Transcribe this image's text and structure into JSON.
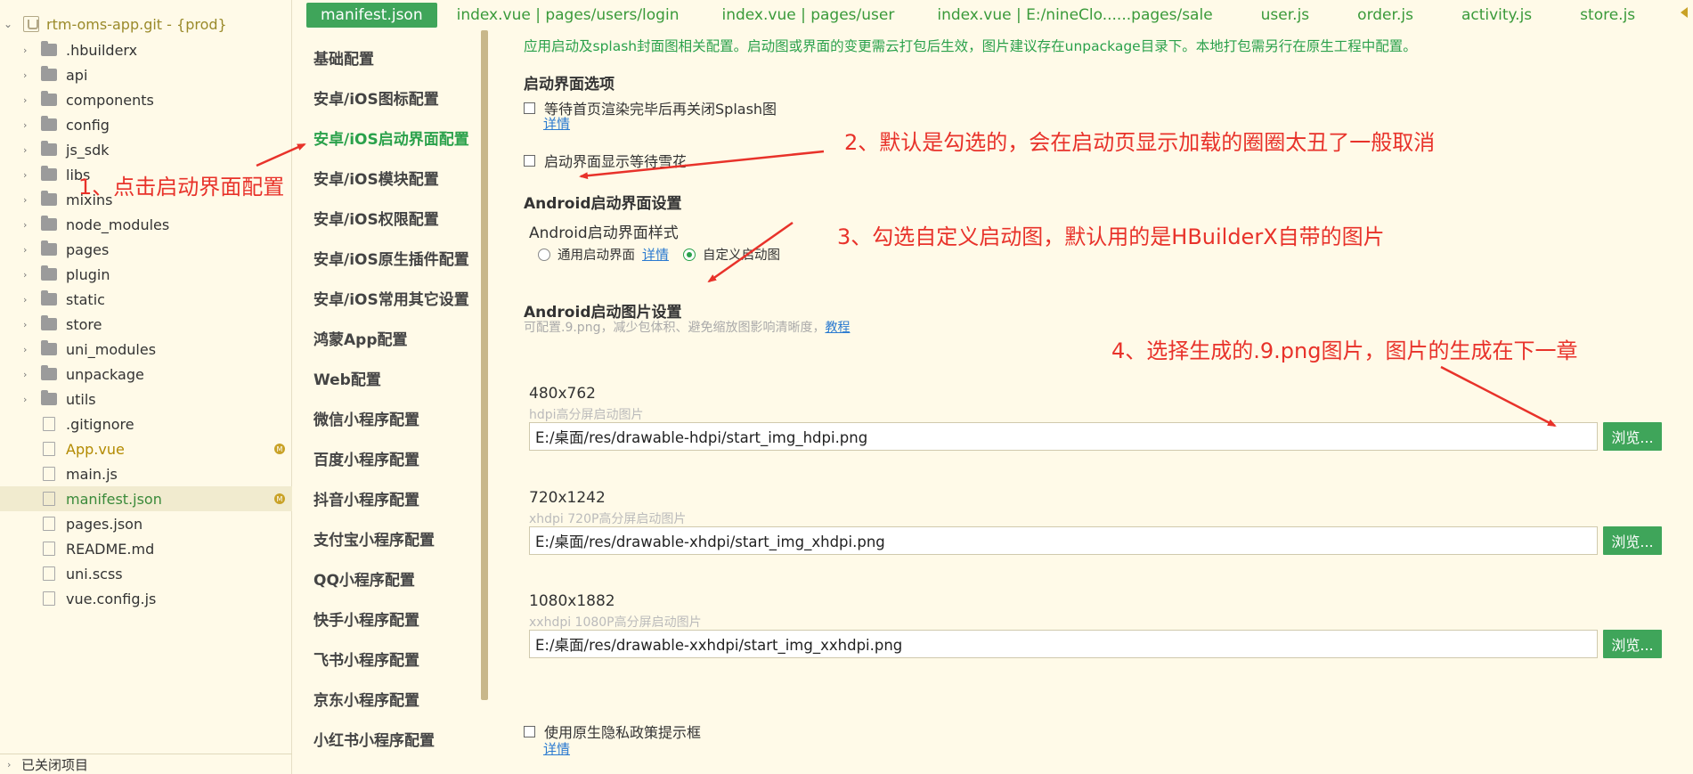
{
  "tree": {
    "root_label": "rtm-oms-app.git - {prod}",
    "items": [
      {
        "label": ".hbuilderx",
        "kind": "folder"
      },
      {
        "label": "api",
        "kind": "folder"
      },
      {
        "label": "components",
        "kind": "folder"
      },
      {
        "label": "config",
        "kind": "folder"
      },
      {
        "label": "js_sdk",
        "kind": "folder"
      },
      {
        "label": "libs",
        "kind": "folder"
      },
      {
        "label": "mixins",
        "kind": "folder"
      },
      {
        "label": "node_modules",
        "kind": "folder"
      },
      {
        "label": "pages",
        "kind": "folder"
      },
      {
        "label": "plugin",
        "kind": "folder"
      },
      {
        "label": "static",
        "kind": "folder"
      },
      {
        "label": "store",
        "kind": "folder"
      },
      {
        "label": "uni_modules",
        "kind": "folder"
      },
      {
        "label": "unpackage",
        "kind": "folder"
      },
      {
        "label": "utils",
        "kind": "folder"
      },
      {
        "label": ".gitignore",
        "kind": "file"
      },
      {
        "label": "App.vue",
        "kind": "file",
        "badge": "M"
      },
      {
        "label": "main.js",
        "kind": "file"
      },
      {
        "label": "manifest.json",
        "kind": "file",
        "badge": "M",
        "active": true
      },
      {
        "label": "pages.json",
        "kind": "file"
      },
      {
        "label": "README.md",
        "kind": "file"
      },
      {
        "label": "uni.scss",
        "kind": "file"
      },
      {
        "label": "vue.config.js",
        "kind": "file"
      }
    ],
    "footer_label": "已关闭项目"
  },
  "tabs": [
    {
      "label": "manifest.json",
      "active": true
    },
    {
      "label": "index.vue | pages/users/login"
    },
    {
      "label": "index.vue | pages/user"
    },
    {
      "label": "index.vue | E:/nineClo......pages/sale"
    },
    {
      "label": "user.js"
    },
    {
      "label": "order.js"
    },
    {
      "label": "activity.js"
    },
    {
      "label": "store.js"
    }
  ],
  "settings_nav": [
    {
      "label": "基础配置"
    },
    {
      "label": "安卓/iOS图标配置"
    },
    {
      "label": "安卓/iOS启动界面配置",
      "active": true
    },
    {
      "label": "安卓/iOS模块配置"
    },
    {
      "label": "安卓/iOS权限配置"
    },
    {
      "label": "安卓/iOS原生插件配置"
    },
    {
      "label": "安卓/iOS常用其它设置"
    },
    {
      "label": "鸿蒙App配置"
    },
    {
      "label": "Web配置"
    },
    {
      "label": "微信小程序配置"
    },
    {
      "label": "百度小程序配置"
    },
    {
      "label": "抖音小程序配置"
    },
    {
      "label": "支付宝小程序配置"
    },
    {
      "label": "QQ小程序配置"
    },
    {
      "label": "快手小程序配置"
    },
    {
      "label": "飞书小程序配置"
    },
    {
      "label": "京东小程序配置"
    },
    {
      "label": "小红书小程序配置"
    }
  ],
  "main": {
    "description": "应用启动及splash封面图相关配置。启动图或界面的变更需云打包后生效，图片建议存在unpackage目录下。本地打包需另行在原生工程中配置。",
    "splash_options_title": "启动界面选项",
    "option_wait_render": "等待首页渲染完毕后再关闭Splash图",
    "detail_link": "详情",
    "option_show_snow": "启动界面显示等待雪花",
    "android_section_title": "Android启动界面设置",
    "android_style_label": "Android启动界面样式",
    "radio_default": "通用启动界面",
    "radio_default_detail": "详情",
    "radio_custom": "自定义启动图",
    "android_images_title": "Android启动图片设置",
    "android_images_hint": "可配置.9.png，减少包体积、避免缩放图影响清晰度，",
    "android_images_hint_link": "教程",
    "images": [
      {
        "size": "480x762",
        "hint": "hdpi高分屏启动图片",
        "path": "E:/桌面/res/drawable-hdpi/start_img_hdpi.png",
        "button": "浏览..."
      },
      {
        "size": "720x1242",
        "hint": "xhdpi 720P高分屏启动图片",
        "path": "E:/桌面/res/drawable-xhdpi/start_img_xhdpi.png",
        "button": "浏览..."
      },
      {
        "size": "1080x1882",
        "hint": "xxhdpi 1080P高分屏启动图片",
        "path": "E:/桌面/res/drawable-xxhdpi/start_img_xxhdpi.png",
        "button": "浏览..."
      }
    ],
    "privacy_option": "使用原生隐私政策提示框",
    "privacy_detail": "详情"
  },
  "annotations": {
    "step1": "1、点击启动界面配置",
    "step2": "2、默认是勾选的，会在启动页显示加载的圈圈太丑了一般取消",
    "step3": "3、勾选自定义启动图，默认用的是HBuilderX自带的图片",
    "step4": "4、选择生成的.9.png图片，图片的生成在下一章"
  },
  "colors": {
    "accent_green": "#3fa55a",
    "annotation_red": "#e8322a",
    "link_blue": "#2a7ad0",
    "background": "#fffae8"
  }
}
